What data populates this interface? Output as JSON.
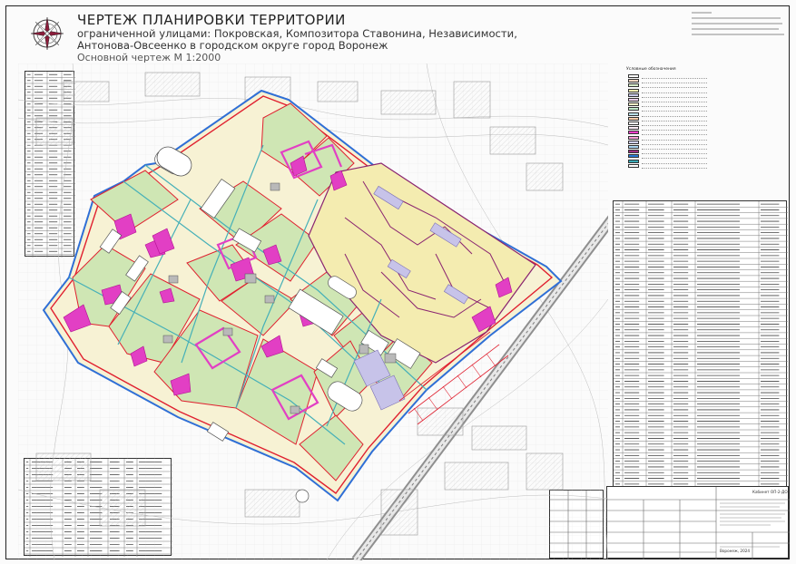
{
  "title": {
    "line1": "ЧЕРТЕЖ ПЛАНИРОВКИ ТЕРРИТОРИИ",
    "line2": "ограниченной улицами: Покровская, Композитора Ставонина, Независимости,",
    "line3": "Антонова-Овсеенко в городском округе город Воронеж",
    "line4": "Основной чертеж М 1:2000"
  },
  "compass": {
    "icon": "compass-rose-icon"
  },
  "colors": {
    "boundary_red": "#e0202f",
    "magenta_zone": "#e23fc4",
    "blue_boundary": "#2f6fd6",
    "residential_green": "#cfe6b4",
    "yellow_fill": "#f4ecb0",
    "purple_plot": "#8a2470",
    "cyan_road": "#46b0b8",
    "lavender_plot": "#c7c3e9"
  },
  "legend": {
    "header": "Условные обозначения",
    "swatches": [
      "#ffffff",
      "#f4d7c2",
      "#d6eac7",
      "#f4ecb0",
      "#c9c9e8",
      "#e6c9e6",
      "#f8f0c8",
      "#bfe6c7",
      "#b9e0e8",
      "#f3c9a6",
      "#ffffff",
      "#fbeaf5",
      "#ea3dc8",
      "#f59fd8",
      "#cfd0f2",
      "#a8d3f0",
      "#9b2f7f",
      "#2a7ad7",
      "#3aa9b5",
      "#ffffff"
    ]
  },
  "stamp": {
    "title": "Кабинет ОП-2-ДО",
    "org": "Воронеж, 2024"
  }
}
